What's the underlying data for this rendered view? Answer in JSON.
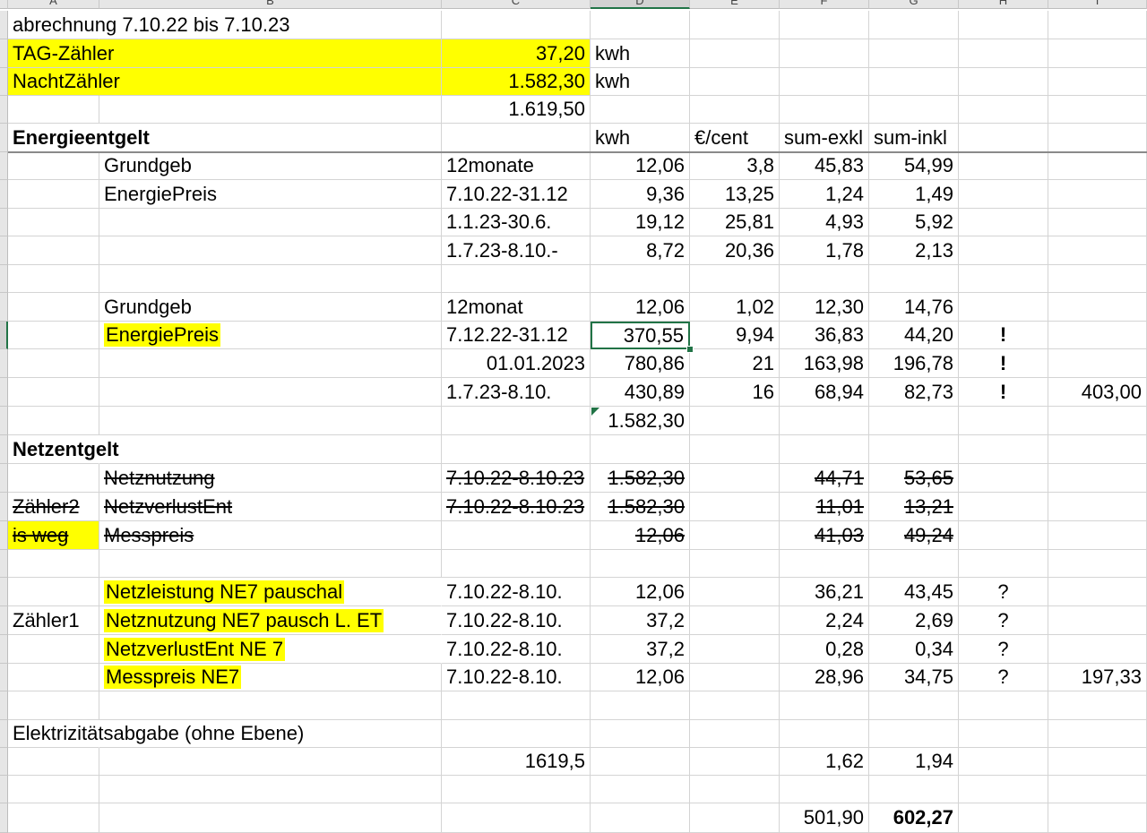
{
  "sheet": {
    "columns": [
      "A",
      "B",
      "C",
      "D",
      "E",
      "F",
      "G",
      "H",
      "I"
    ],
    "selected_column": "D",
    "rows": [
      {
        "cells": [
          {
            "col": "A",
            "text": "abrechnung 7.10.22 bis 7.10.23",
            "ov": true
          }
        ]
      },
      {
        "cells": [
          {
            "col": "A",
            "text": "TAG-Zähler",
            "ov": true,
            "fill": true
          },
          {
            "col": "B",
            "text": "",
            "fill": true
          },
          {
            "col": "C",
            "text": "37,20",
            "align": "r",
            "fill": true
          },
          {
            "col": "D",
            "text": "kwh"
          }
        ]
      },
      {
        "cells": [
          {
            "col": "A",
            "text": "NachtZähler",
            "ov": true,
            "fill": true
          },
          {
            "col": "B",
            "text": "",
            "fill": true
          },
          {
            "col": "C",
            "text": "1.582,30",
            "align": "r",
            "fill": true
          },
          {
            "col": "D",
            "text": "kwh"
          }
        ]
      },
      {
        "cells": [
          {
            "col": "C",
            "text": "1.619,50",
            "align": "r"
          }
        ]
      },
      {
        "line": true,
        "cells": [
          {
            "col": "A",
            "text": "Energieentgelt",
            "ov": true,
            "bold": true
          },
          {
            "col": "D",
            "text": "kwh"
          },
          {
            "col": "E",
            "text": "€/cent"
          },
          {
            "col": "F",
            "text": "sum-exkl"
          },
          {
            "col": "G",
            "text": "sum-inkl"
          }
        ]
      },
      {
        "cells": [
          {
            "col": "B",
            "text": "Grundgeb"
          },
          {
            "col": "C",
            "text": "12monate"
          },
          {
            "col": "D",
            "text": "12,06",
            "align": "r"
          },
          {
            "col": "E",
            "text": "3,8",
            "align": "r"
          },
          {
            "col": "F",
            "text": "45,83",
            "align": "r"
          },
          {
            "col": "G",
            "text": "54,99",
            "align": "r"
          }
        ]
      },
      {
        "cells": [
          {
            "col": "B",
            "text": "EnergiePreis"
          },
          {
            "col": "C",
            "text": "7.10.22-31.12"
          },
          {
            "col": "D",
            "text": "9,36",
            "align": "r"
          },
          {
            "col": "E",
            "text": "13,25",
            "align": "r"
          },
          {
            "col": "F",
            "text": "1,24",
            "align": "r"
          },
          {
            "col": "G",
            "text": "1,49",
            "align": "r"
          }
        ]
      },
      {
        "cells": [
          {
            "col": "C",
            "text": "1.1.23-30.6."
          },
          {
            "col": "D",
            "text": "19,12",
            "align": "r"
          },
          {
            "col": "E",
            "text": "25,81",
            "align": "r"
          },
          {
            "col": "F",
            "text": "4,93",
            "align": "r"
          },
          {
            "col": "G",
            "text": "5,92",
            "align": "r"
          }
        ]
      },
      {
        "cells": [
          {
            "col": "C",
            "text": "1.7.23-8.10.-"
          },
          {
            "col": "D",
            "text": "8,72",
            "align": "r"
          },
          {
            "col": "E",
            "text": "20,36",
            "align": "r"
          },
          {
            "col": "F",
            "text": "1,78",
            "align": "r"
          },
          {
            "col": "G",
            "text": "2,13",
            "align": "r"
          }
        ]
      },
      {
        "cells": []
      },
      {
        "cells": [
          {
            "col": "B",
            "text": "Grundgeb"
          },
          {
            "col": "C",
            "text": "12monat"
          },
          {
            "col": "D",
            "text": "12,06",
            "align": "r"
          },
          {
            "col": "E",
            "text": "1,02",
            "align": "r"
          },
          {
            "col": "F",
            "text": "12,30",
            "align": "r"
          },
          {
            "col": "G",
            "text": "14,76",
            "align": "r"
          }
        ]
      },
      {
        "selected_row": true,
        "cells": [
          {
            "col": "B",
            "text": "EnergiePreis",
            "hl": true
          },
          {
            "col": "C",
            "text": "7.12.22-31.12"
          },
          {
            "col": "D",
            "text": "370,55",
            "align": "r",
            "selected": true
          },
          {
            "col": "E",
            "text": "9,94",
            "align": "r"
          },
          {
            "col": "F",
            "text": "36,83",
            "align": "r"
          },
          {
            "col": "G",
            "text": "44,20",
            "align": "r"
          },
          {
            "col": "H",
            "text": "!",
            "align": "c",
            "bold": true
          }
        ]
      },
      {
        "cells": [
          {
            "col": "C",
            "text": "01.01.2023",
            "align": "r"
          },
          {
            "col": "D",
            "text": "780,86",
            "align": "r"
          },
          {
            "col": "E",
            "text": "21",
            "align": "r"
          },
          {
            "col": "F",
            "text": "163,98",
            "align": "r"
          },
          {
            "col": "G",
            "text": "196,78",
            "align": "r"
          },
          {
            "col": "H",
            "text": "!",
            "align": "c",
            "bold": true
          }
        ]
      },
      {
        "cells": [
          {
            "col": "C",
            "text": "1.7.23-8.10."
          },
          {
            "col": "D",
            "text": "430,89",
            "align": "r"
          },
          {
            "col": "E",
            "text": "16",
            "align": "r"
          },
          {
            "col": "F",
            "text": "68,94",
            "align": "r"
          },
          {
            "col": "G",
            "text": "82,73",
            "align": "r"
          },
          {
            "col": "H",
            "text": "!",
            "align": "c",
            "bold": true
          },
          {
            "col": "I",
            "text": "403,00",
            "align": "r"
          }
        ]
      },
      {
        "cells": [
          {
            "col": "D",
            "text": "1.582,30",
            "align": "r",
            "tri": true
          }
        ]
      },
      {
        "cells": [
          {
            "col": "A",
            "text": "Netzentgelt",
            "ov": true,
            "bold": true
          }
        ]
      },
      {
        "cells": [
          {
            "col": "B",
            "text": "Netznutzung",
            "strike": true
          },
          {
            "col": "C",
            "text": "7.10.22-8.10.23",
            "strike": true
          },
          {
            "col": "D",
            "text": "1.582,30",
            "align": "r",
            "strike": true
          },
          {
            "col": "F",
            "text": "44,71",
            "align": "r",
            "strike": true
          },
          {
            "col": "G",
            "text": "53,65",
            "align": "r",
            "strike": true
          }
        ]
      },
      {
        "cells": [
          {
            "col": "A",
            "text": "Zähler2",
            "strike": true
          },
          {
            "col": "B",
            "text": "NetzverlustEnt",
            "strike": true
          },
          {
            "col": "C",
            "text": "7.10.22-8.10.23",
            "strike": true
          },
          {
            "col": "D",
            "text": "1.582,30",
            "align": "r",
            "strike": true
          },
          {
            "col": "F",
            "text": "11,01",
            "align": "r",
            "strike": true
          },
          {
            "col": "G",
            "text": "13,21",
            "align": "r",
            "strike": true
          }
        ]
      },
      {
        "cells": [
          {
            "col": "A",
            "text": "is weg",
            "strike": true,
            "fill": true
          },
          {
            "col": "B",
            "text": "Messpreis",
            "strike": true
          },
          {
            "col": "D",
            "text": "12,06",
            "align": "r",
            "strike": true
          },
          {
            "col": "F",
            "text": "41,03",
            "align": "r",
            "strike": true
          },
          {
            "col": "G",
            "text": "49,24",
            "align": "r",
            "strike": true
          }
        ]
      },
      {
        "cells": []
      },
      {
        "cells": [
          {
            "col": "B",
            "text": "Netzleistung NE7 pauschal",
            "ov": true,
            "hl": true
          },
          {
            "col": "C",
            "text": "7.10.22-8.10."
          },
          {
            "col": "D",
            "text": "12,06",
            "align": "r"
          },
          {
            "col": "F",
            "text": "36,21",
            "align": "r"
          },
          {
            "col": "G",
            "text": "43,45",
            "align": "r"
          },
          {
            "col": "H",
            "text": "?",
            "align": "c"
          }
        ]
      },
      {
        "cells": [
          {
            "col": "A",
            "text": "Zähler1"
          },
          {
            "col": "B",
            "text": "Netznutzung NE7 pausch L. ET",
            "ov": true,
            "hl": true
          },
          {
            "col": "C",
            "text": "7.10.22-8.10."
          },
          {
            "col": "D",
            "text": "37,2",
            "align": "r"
          },
          {
            "col": "F",
            "text": "2,24",
            "align": "r"
          },
          {
            "col": "G",
            "text": "2,69",
            "align": "r"
          },
          {
            "col": "H",
            "text": "?",
            "align": "c"
          }
        ]
      },
      {
        "cells": [
          {
            "col": "B",
            "text": "NetzverlustEnt NE 7",
            "ov": true,
            "hl": true
          },
          {
            "col": "C",
            "text": "7.10.22-8.10."
          },
          {
            "col": "D",
            "text": "37,2",
            "align": "r"
          },
          {
            "col": "F",
            "text": "0,28",
            "align": "r"
          },
          {
            "col": "G",
            "text": "0,34",
            "align": "r"
          },
          {
            "col": "H",
            "text": "?",
            "align": "c"
          }
        ]
      },
      {
        "cells": [
          {
            "col": "B",
            "text": "Messpreis NE7",
            "hl": true
          },
          {
            "col": "C",
            "text": "7.10.22-8.10."
          },
          {
            "col": "D",
            "text": "12,06",
            "align": "r"
          },
          {
            "col": "F",
            "text": "28,96",
            "align": "r"
          },
          {
            "col": "G",
            "text": "34,75",
            "align": "r"
          },
          {
            "col": "H",
            "text": "?",
            "align": "c"
          },
          {
            "col": "I",
            "text": "197,33",
            "align": "r"
          }
        ]
      },
      {
        "cells": []
      },
      {
        "cells": [
          {
            "col": "A",
            "text": "Elektrizitätsabgabe (ohne Ebene)",
            "ov": true
          }
        ]
      },
      {
        "cells": [
          {
            "col": "C",
            "text": "1619,5",
            "align": "r"
          },
          {
            "col": "F",
            "text": "1,62",
            "align": "r"
          },
          {
            "col": "G",
            "text": "1,94",
            "align": "r"
          }
        ]
      },
      {
        "cells": []
      },
      {
        "cells": [
          {
            "col": "F",
            "text": "501,90",
            "align": "r"
          },
          {
            "col": "G",
            "text": "602,27",
            "align": "r",
            "bold": true
          }
        ]
      }
    ]
  },
  "colors": {
    "highlight": "#ffff00",
    "selection": "#217346"
  }
}
